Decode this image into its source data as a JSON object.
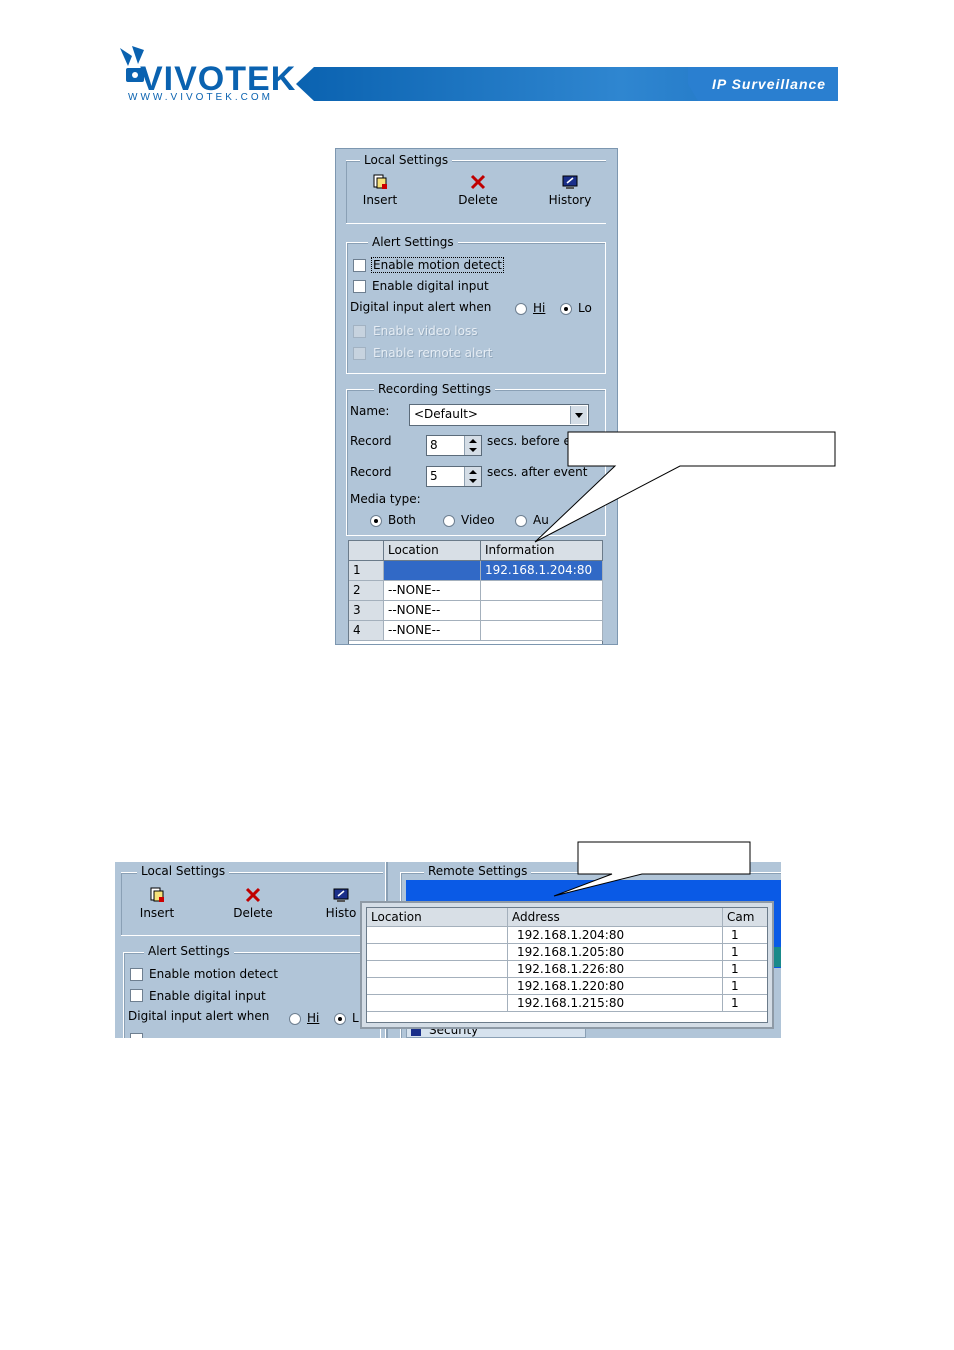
{
  "header": {
    "brand": "VIVOTEK",
    "url": "WWW.VIVOTEK.COM",
    "tagline": "IP Surveillance"
  },
  "colors": {
    "brand_blue": "#0a62b0",
    "panel_bg": "#b1c5d8",
    "selection": "#3169c6"
  },
  "screenshot1": {
    "local_settings": {
      "title": "Local Settings",
      "tools": [
        {
          "label": "Insert",
          "icon": "insert-icon"
        },
        {
          "label": "Delete",
          "icon": "delete-icon"
        },
        {
          "label": "History",
          "icon": "history-icon"
        }
      ]
    },
    "alert_settings": {
      "title": "Alert Settings",
      "motion": "Enable motion detect",
      "digital": "Enable digital input",
      "digital_when": "Digital input alert when",
      "hi": "Hi",
      "lo": "Lo",
      "video_loss": "Enable video loss",
      "remote_alert": "Enable remote alert"
    },
    "recording_settings": {
      "title": "Recording Settings",
      "name_label": "Name:",
      "name_value": "<Default>",
      "record_label": "Record",
      "before_value": "8",
      "before_text": "secs. before e",
      "after_value": "5",
      "after_text": "secs. after event",
      "media_label": "Media type:",
      "media_options": [
        "Both",
        "Video",
        "Au"
      ]
    },
    "table": {
      "headers": [
        "Location",
        "Information"
      ],
      "rows": [
        {
          "num": "1",
          "location": "",
          "info": "192.168.1.204:80"
        },
        {
          "num": "2",
          "location": "--NONE--",
          "info": ""
        },
        {
          "num": "3",
          "location": "--NONE--",
          "info": ""
        },
        {
          "num": "4",
          "location": "--NONE--",
          "info": ""
        }
      ]
    }
  },
  "screenshot2": {
    "local_settings": {
      "title": "Local Settings",
      "tools": [
        "Insert",
        "Delete",
        "Histo"
      ]
    },
    "alert_settings": {
      "title": "Alert Settings",
      "motion": "Enable motion detect",
      "digital": "Enable digital input",
      "digital_when": "Digital input alert when",
      "hi": "Hi",
      "lo": "L"
    },
    "remote_settings": {
      "title": "Remote Settings",
      "partial_item": "Security"
    },
    "list": {
      "headers": [
        "Location",
        "Address",
        "Cam"
      ],
      "rows": [
        {
          "location": "",
          "address": "192.168.1.204:80",
          "cam": "1"
        },
        {
          "location": "",
          "address": "192.168.1.205:80",
          "cam": "1"
        },
        {
          "location": "",
          "address": "192.168.1.226:80",
          "cam": "1"
        },
        {
          "location": "",
          "address": "192.168.1.220:80",
          "cam": "1"
        },
        {
          "location": "",
          "address": "192.168.1.215:80",
          "cam": "1"
        }
      ]
    }
  }
}
